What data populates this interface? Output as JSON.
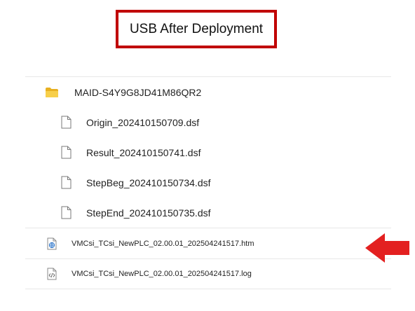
{
  "title": "USB After Deployment",
  "folder": {
    "name": "MAID-S4Y9G8JD41M86QR2",
    "icon": "folder-icon",
    "files": [
      {
        "name": "Origin_202410150709.dsf",
        "icon": "file-icon"
      },
      {
        "name": "Result_202410150741.dsf",
        "icon": "file-icon"
      },
      {
        "name": "StepBeg_202410150734.dsf",
        "icon": "file-icon"
      },
      {
        "name": "StepEnd_202410150735.dsf",
        "icon": "file-icon"
      }
    ]
  },
  "root_files": [
    {
      "name": "VMCsi_TCsi_NewPLC_02.00.01_202504241517.htm",
      "icon": "html-file-icon"
    },
    {
      "name": "VMCsi_TCsi_NewPLC_02.00.01_202504241517.log",
      "icon": "code-file-icon"
    }
  ],
  "colors": {
    "highlight_red": "#c00000",
    "arrow_red": "#e32020",
    "folder_yellow": "#f2c234",
    "divider": "#e7e7e7"
  }
}
